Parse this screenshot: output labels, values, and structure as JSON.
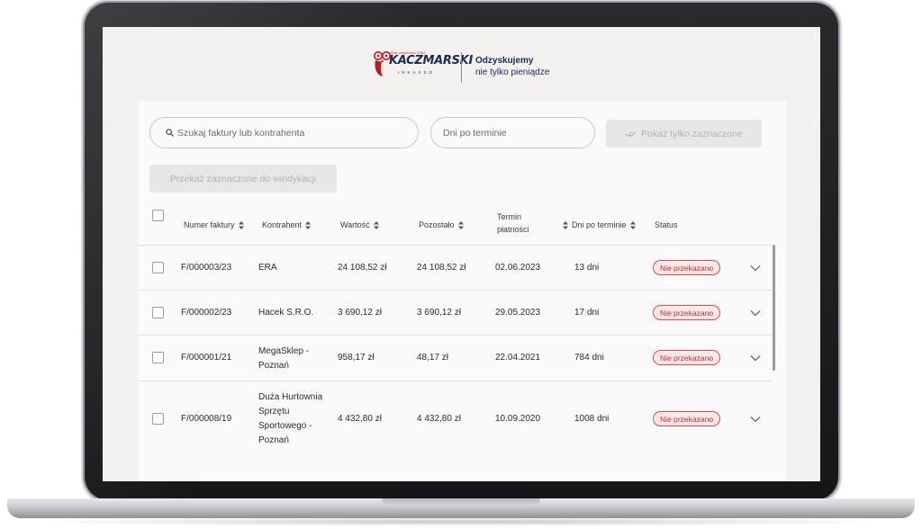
{
  "brand": {
    "logo_text": "KACZMARSKI",
    "logo_sub": "INKASSO",
    "logo_small": "Rok założenia 1991",
    "tagline_1": "Odzyskujemy",
    "tagline_2": "nie tylko pieniądze"
  },
  "filters": {
    "search_placeholder": "Szukaj faktury lub kontrahenta",
    "days_placeholder": "Dni po terminie",
    "show_selected_label": "Pokaż tylko zaznaczone",
    "send_selected_label": "Przekaż zaznaczone do windykacji"
  },
  "table": {
    "columns": {
      "invoice": "Numer faktury",
      "contractor": "Kontrahent",
      "value": "Wartość",
      "remaining": "Pozostało",
      "due": "Termin płatności",
      "days": "Dni po terminie",
      "status": "Status"
    },
    "rows": [
      {
        "invoice": "F/000003/23",
        "contractor": "ERA",
        "value": "24 108,52 zł",
        "remaining": "24 108,52 zł",
        "due": "02.06.2023",
        "days": "13 dni",
        "status": "Nie przekazano"
      },
      {
        "invoice": "F/000002/23",
        "contractor": "Hacek S.R.O.",
        "value": "3 690,12 zł",
        "remaining": "3 690,12 zł",
        "due": "29.05.2023",
        "days": "17 dni",
        "status": "Nie przekazano"
      },
      {
        "invoice": "F/000001/21",
        "contractor": "MegaSklep - Poznań",
        "value": "958,17 zł",
        "remaining": "48,17 zł",
        "due": "22.04.2021",
        "days": "784 dni",
        "status": "Nie przekazano"
      },
      {
        "invoice": "F/000008/19",
        "contractor": "Duża Hurtownia Sprzętu Sportowego - Poznań",
        "value": "4 432,80 zł",
        "remaining": "4 432,80 zł",
        "due": "10.09.2020",
        "days": "1008 dni",
        "status": "Nie przekazano"
      }
    ]
  },
  "colors": {
    "brand_navy": "#1b2b54",
    "brand_red": "#c4161c",
    "status_red": "#e5484d",
    "status_bg": "#fde8e8"
  }
}
